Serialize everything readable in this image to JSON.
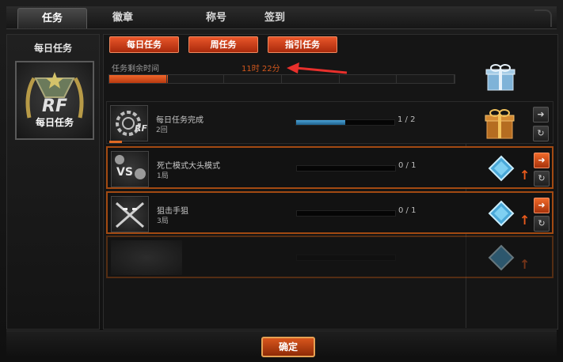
{
  "tabs": [
    "任务",
    "徽章",
    "称号",
    "签到"
  ],
  "left_panel": {
    "title": "每日任务",
    "emblem_label": "每日任务"
  },
  "subtabs": [
    "每日任务",
    "周任务",
    "指引任务"
  ],
  "timer": {
    "label": "任务剩余时间",
    "value": "11时 22分",
    "progress": 0.17,
    "segments": 6
  },
  "tasks": [
    {
      "name": "每日任务完成",
      "count": "2回",
      "progress_text": "1 / 2",
      "progress": 0.5,
      "icon": "gear-rf-icon",
      "reward": "gift-box-icon",
      "framed": false
    },
    {
      "name": "死亡模式大头模式",
      "count": "1局",
      "progress_text": "0 / 1",
      "progress": 0,
      "icon": "vs-icon",
      "reward": "diamond-icon",
      "framed": true
    },
    {
      "name": "狙击手狙",
      "count": "3局",
      "progress_text": "0 / 1",
      "progress": 0,
      "icon": "crossed-rifles-icon",
      "reward": "diamond-icon",
      "framed": true
    }
  ],
  "confirm_label": "确定",
  "colors": {
    "accent": "#e0531f",
    "bar_fill": "#3b8fc6",
    "frame": "#a24a12"
  }
}
